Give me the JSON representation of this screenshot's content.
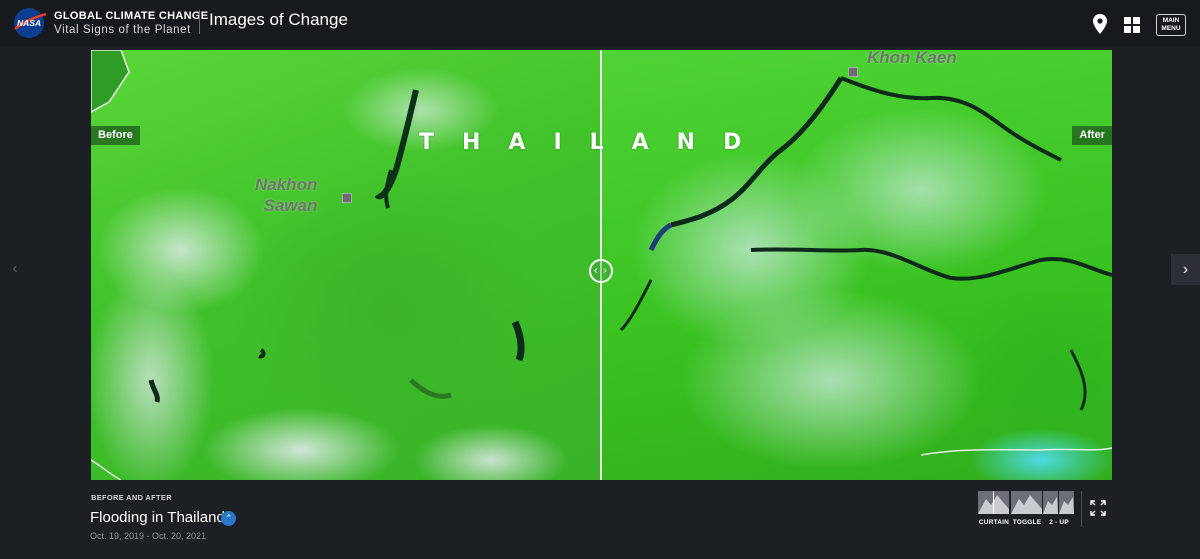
{
  "header": {
    "logo_text": "NASA",
    "brand_title": "GLOBAL CLIMATE CHANGE",
    "brand_subtitle": "Vital Signs of the Planet",
    "page_heading": "Images of Change",
    "icons": [
      "location-pin-icon",
      "grid-icon"
    ],
    "main_menu_line1": "MAIN",
    "main_menu_line2": "MENU"
  },
  "navigation": {
    "prev_icon": "chevron-left-icon",
    "next_icon": "chevron-right-icon",
    "prev_glyph": "‹",
    "next_glyph": "›"
  },
  "viewer": {
    "before_label": "Before",
    "after_label": "After",
    "country_label": "THAILAND",
    "city_1_line1": "Nakhon",
    "city_1_line2": "Sawan",
    "city_2": "Khon Kaen",
    "handle_icon": "drag-handle-icon",
    "handle_left": "‹",
    "handle_right": "›"
  },
  "info": {
    "eyebrow": "BEFORE AND AFTER",
    "title": "Flooding in Thailand",
    "toggle_icon": "chevron-up-icon",
    "toggle_glyph": "⌃",
    "date_range": "Oct. 19, 2019 - Oct. 20, 2021"
  },
  "modes": {
    "curtain_label": "CURTAIN",
    "toggle_label": "TOGGLE",
    "twoup_label": "2 - UP",
    "active": "curtain",
    "fullscreen_icon": "fullscreen-icon"
  },
  "colors": {
    "background": "#1c1f24",
    "header": "#16191d",
    "accent": "#2a78c9",
    "vegetation": "#41c22b",
    "water": "#0f2a1a"
  }
}
